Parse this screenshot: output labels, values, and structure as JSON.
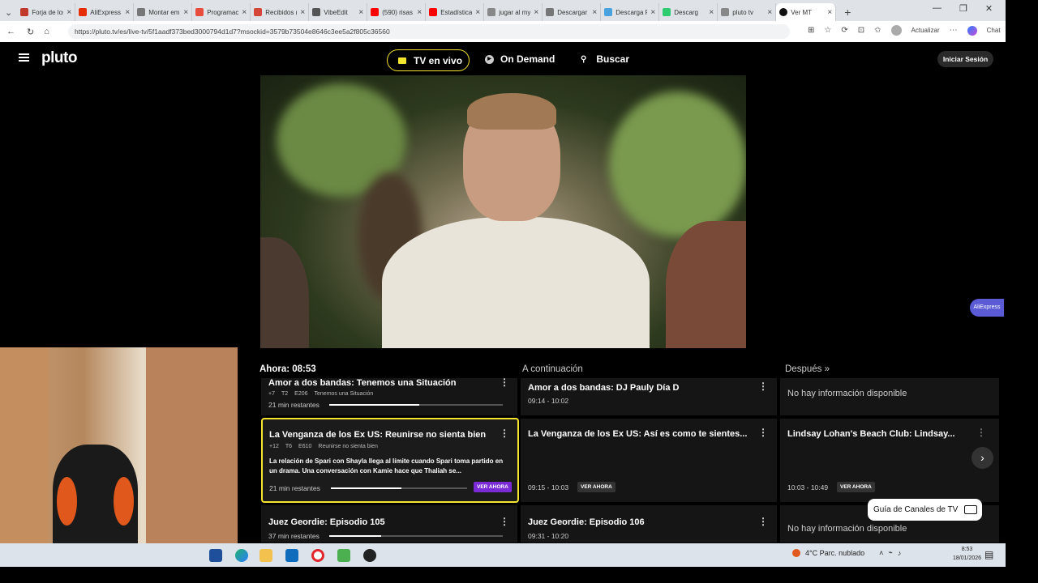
{
  "browser": {
    "tabs": [
      {
        "title": "Forja de los",
        "color": "#c0392b"
      },
      {
        "title": "AliExpress",
        "color": "#e62e04"
      },
      {
        "title": "Montar emp",
        "color": "#777777"
      },
      {
        "title": "Programaci",
        "color": "#e74c3c"
      },
      {
        "title": "Recibidos (",
        "color": "#d44638"
      },
      {
        "title": "VibeEdit",
        "color": "#555555"
      },
      {
        "title": "(590) risas",
        "color": "#ff0000"
      },
      {
        "title": "Estadísticas",
        "color": "#ff0000"
      },
      {
        "title": "jugar al my",
        "color": "#888888"
      },
      {
        "title": "Descargar",
        "color": "#777777"
      },
      {
        "title": "Descarga R",
        "color": "#4aa3df"
      },
      {
        "title": "Descarg",
        "color": "#2ecc71"
      },
      {
        "title": "pluto tv",
        "color": "#888888"
      },
      {
        "title": "Ver MT",
        "color": "#111111",
        "active": true
      }
    ],
    "url": "https://pluto.tv/es/live-tv/5f1aadf373bed3000794d1d7?msockid=3579b73504e8646c3ee5a2f805c36560",
    "update_label": "Actualizar",
    "chat_label": "Chat"
  },
  "pluto": {
    "logo": "pluto",
    "nav": {
      "live": "TV en vivo",
      "on_demand": "On Demand",
      "search": "Buscar"
    },
    "login": "Iniciar Sesión",
    "aliexpress_tab": "AliExpress"
  },
  "guide": {
    "headers": {
      "now": "Ahora: 08:53",
      "next": "A continuación",
      "after": "Después"
    },
    "rows": [
      {
        "now": {
          "title": "Amor a dos bandas: Tenemos una Situación",
          "rating": "+7",
          "season": "T2",
          "episode": "E206",
          "ep_title": "Tenemos una Situación",
          "remaining": "21 min restantes",
          "progress": 0.52
        },
        "next": {
          "title": "Amor a dos bandas: DJ Pauly Día D",
          "time": "09:14 - 10:02"
        },
        "after": {
          "title": "No hay información disponible"
        }
      },
      {
        "now": {
          "title": "La Venganza de los Ex US: Reunirse no sienta bien",
          "rating": "+12",
          "season": "T6",
          "episode": "E610",
          "ep_title": "Reunirse no sienta bien",
          "description": "La relación de Spari con Shayla llega al límite cuando Spari toma partido en un drama. Una conversación con Kamie hace que Thaliah se...",
          "remaining": "21 min restantes",
          "progress": 0.52,
          "cta": "VER AHORA"
        },
        "next": {
          "title": "La Venganza de los Ex US: Así es como te sientes...",
          "time": "09:15 - 10:03",
          "cta": "VER AHORA"
        },
        "after": {
          "title": "Lindsay Lohan's Beach Club: Lindsay...",
          "time": "10:03 - 10:49",
          "cta": "VER AHORA"
        }
      },
      {
        "now": {
          "title": "Juez Geordie: Episodio 105",
          "remaining": "37 min restantes",
          "progress": 0.3
        },
        "next": {
          "title": "Juez Geordie: Episodio 106",
          "time": "09:31 - 10:20"
        },
        "after": {
          "title": "No hay información disponible"
        }
      }
    ],
    "channel_guide_button": "Guía de Canales de TV"
  },
  "taskbar": {
    "weather": "4°C  Parc. nublado",
    "time": "8:53",
    "date": "18/01/2026"
  }
}
